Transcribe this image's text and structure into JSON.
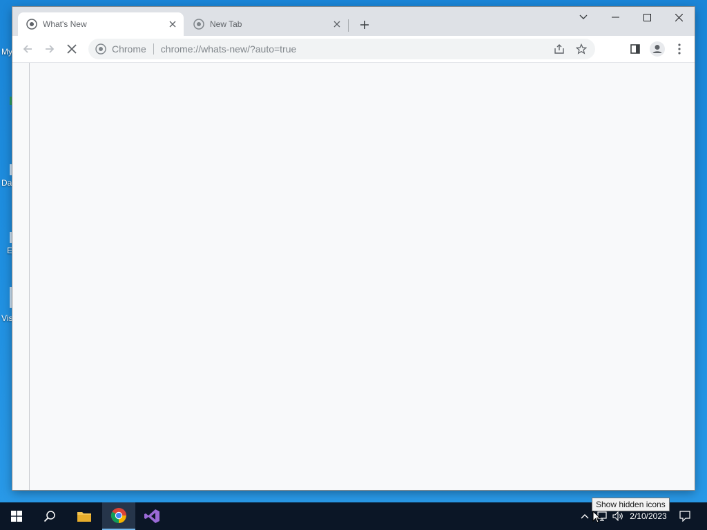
{
  "desktop": {
    "icons": [
      {
        "label": "My"
      },
      {
        "label": ""
      },
      {
        "label": "Da"
      },
      {
        "label": "E"
      },
      {
        "label": "Vis"
      }
    ]
  },
  "browser": {
    "tabs": [
      {
        "title": "What's New",
        "active": true
      },
      {
        "title": "New Tab",
        "active": false
      }
    ],
    "omnibox": {
      "chip": "Chrome",
      "url": "chrome://whats-new/?auto=true"
    },
    "loading": true
  },
  "taskbar": {
    "apps": [
      "start-icon",
      "search-icon",
      "file-explorer-icon",
      "chrome-icon",
      "visual-studio-icon"
    ],
    "active_app": "chrome-icon",
    "clock": {
      "time": "",
      "date": "2/10/2023"
    },
    "tooltip": "Show hidden icons"
  },
  "colors": {
    "desktop_bg": "#1f8fe0",
    "taskbar_bg": "#0b1626",
    "tabstrip_bg": "#dee1e6",
    "content_bg": "#f8f9fa",
    "visual_studio_purple": "#68217a"
  }
}
